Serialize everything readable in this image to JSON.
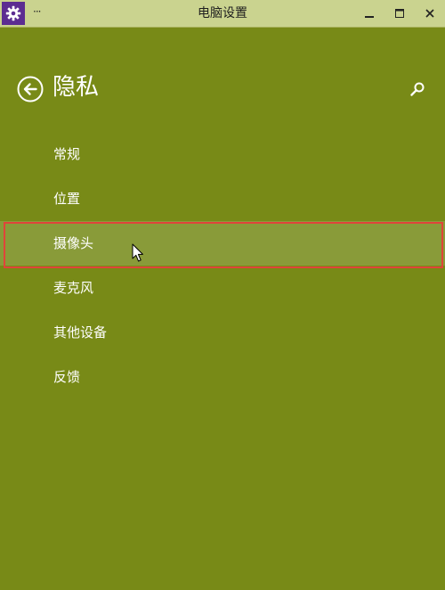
{
  "window": {
    "title": "电脑设置",
    "more_label": "···"
  },
  "colors": {
    "background": "#788a17",
    "titlebar": "#cad38f",
    "app_icon": "#5c2d91",
    "selected_item": "#899b39",
    "highlight_border": "#e0443a",
    "text": "#ffffff"
  },
  "header": {
    "title": "隐私",
    "back_icon": "back-arrow-circle",
    "search_icon": "search-magnifier"
  },
  "nav": {
    "items": [
      {
        "label": "常规"
      },
      {
        "label": "位置"
      },
      {
        "label": "摄像头"
      },
      {
        "label": "麦克风"
      },
      {
        "label": "其他设备"
      },
      {
        "label": "反馈"
      }
    ],
    "selected_index": 2
  }
}
